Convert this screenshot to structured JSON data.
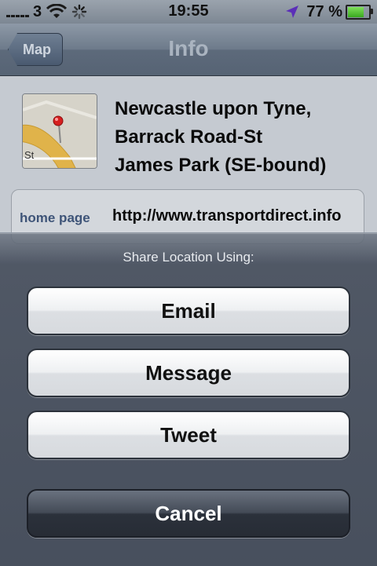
{
  "status_bar": {
    "carrier": "3",
    "time": "19:55",
    "battery_percent": "77 %",
    "battery_level": 0.77,
    "icons": [
      "signal-icon",
      "wifi-icon",
      "activity-icon",
      "location-arrow-icon",
      "battery-icon"
    ]
  },
  "nav": {
    "back_label": "Map",
    "title": "Info"
  },
  "place": {
    "name": "Newcastle upon Tyne,\nBarrack Road-St\nJames Park (SE-bound)",
    "thumb_label": "St"
  },
  "info_rows": [
    {
      "label": "home page",
      "value": "http://www.transportdirect.info"
    }
  ],
  "action_sheet": {
    "title": "Share Location Using:",
    "buttons": {
      "email": "Email",
      "message": "Message",
      "tweet": "Tweet",
      "cancel": "Cancel"
    }
  },
  "colors": {
    "nav_bar": "#6d7a8a",
    "sheet_background": "#464e5c",
    "cancel_button": "#2b313b",
    "label_blue": "#3e5478"
  }
}
